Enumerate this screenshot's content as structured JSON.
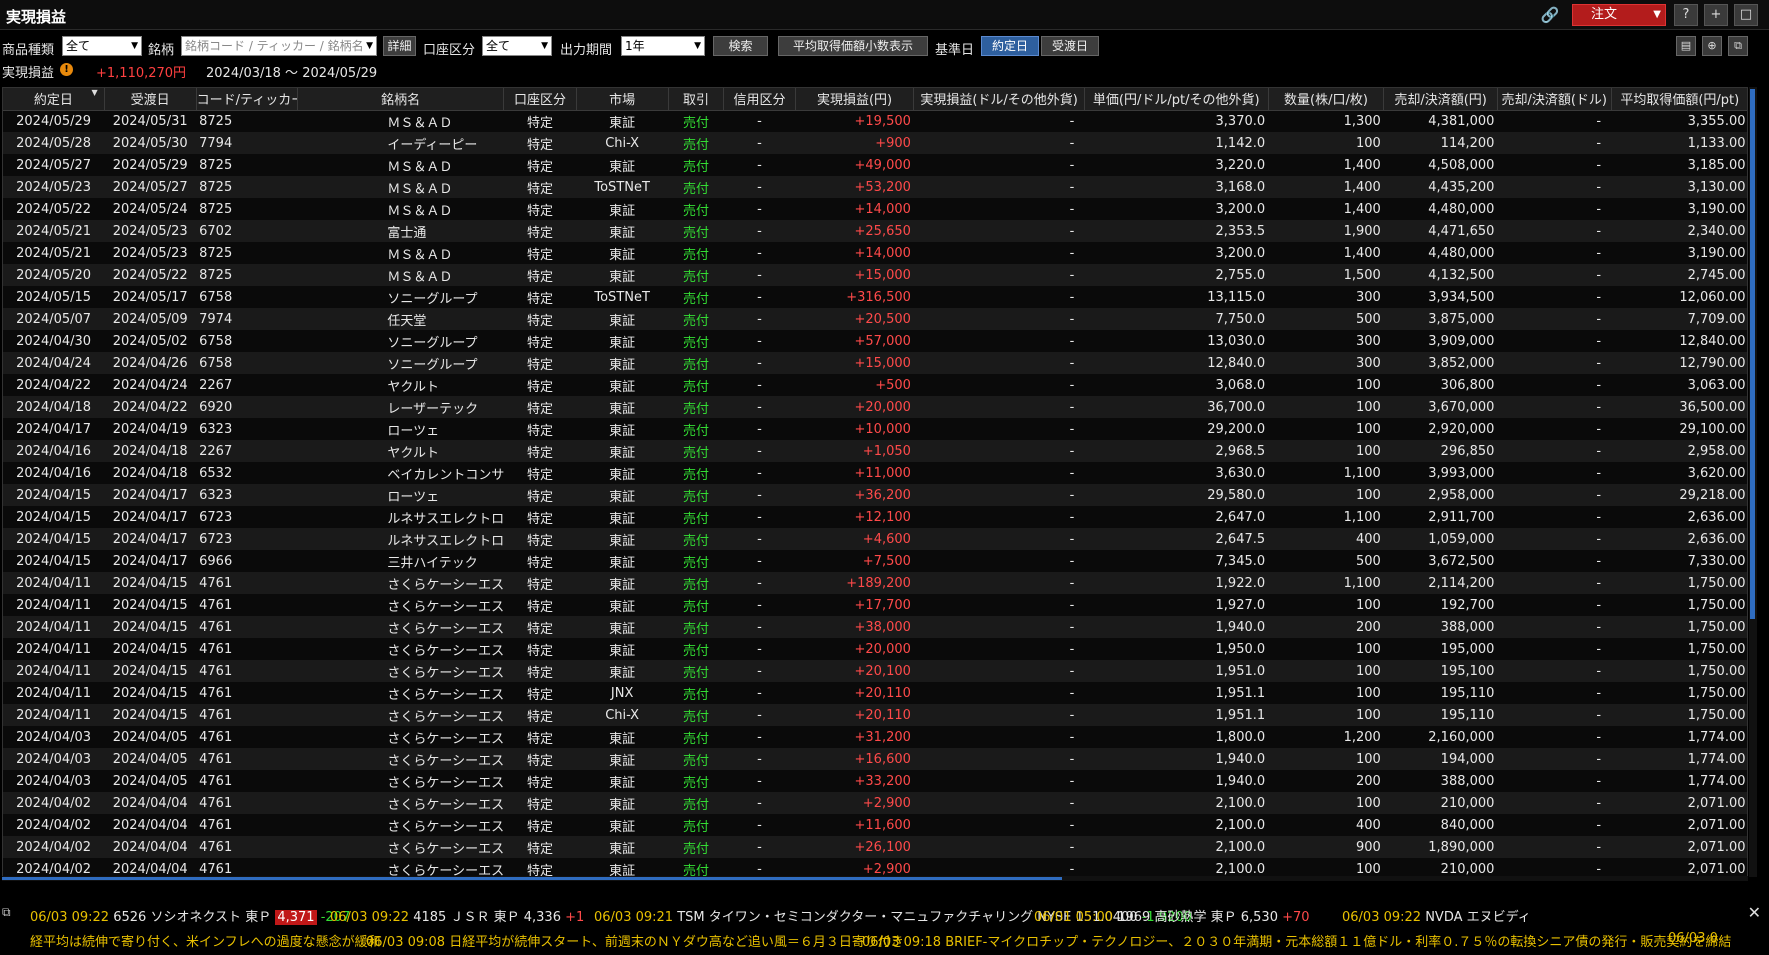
{
  "window": {
    "title": "実現損益",
    "order_label": "注文",
    "buttons": [
      "?",
      "+",
      "□"
    ]
  },
  "filters": {
    "product_type_label": "商品種類",
    "product_type_value": "全て",
    "symbol_label": "銘柄",
    "symbol_placeholder": "銘柄コード / ティッカー / 銘柄名",
    "detail_button": "詳細",
    "account_label": "口座区分",
    "account_value": "全て",
    "period_label": "出力期間",
    "period_value": "1年",
    "search_button": "検索",
    "avg_price_button": "平均取得価額小数表示",
    "base_date_label": "基準日",
    "trade_date_button": "約定日",
    "settle_date_button": "受渡日"
  },
  "summary": {
    "label": "実現損益",
    "total": "+1,110,270円",
    "period": "2024/03/18 ～ 2024/05/29"
  },
  "table": {
    "columns": [
      "約定日",
      "受渡日",
      "コード/ティッカー",
      "銘柄名",
      "口座区分",
      "市場",
      "取引",
      "信用区分",
      "実現損益(円)",
      "実現損益(ドル/その他外貨)",
      "単価(円/ドル/pt/その他外貨)",
      "数量(株/口/枚)",
      "売却/決済額(円)",
      "売却/決済額(ドル)",
      "平均取得価額(円/pt)"
    ],
    "rows": [
      [
        "2024/05/29",
        "2024/05/31",
        "8725",
        "ＭＳ＆ＡＤ",
        "特定",
        "東証",
        "売付",
        "-",
        "+19,500",
        "-",
        "3,370.0",
        "1,300",
        "4,381,000",
        "-",
        "3,355.00"
      ],
      [
        "2024/05/28",
        "2024/05/30",
        "7794",
        "イーディーピー",
        "特定",
        "Chi-X",
        "売付",
        "-",
        "+900",
        "-",
        "1,142.0",
        "100",
        "114,200",
        "-",
        "1,133.00"
      ],
      [
        "2024/05/27",
        "2024/05/29",
        "8725",
        "ＭＳ＆ＡＤ",
        "特定",
        "東証",
        "売付",
        "-",
        "+49,000",
        "-",
        "3,220.0",
        "1,400",
        "4,508,000",
        "-",
        "3,185.00"
      ],
      [
        "2024/05/23",
        "2024/05/27",
        "8725",
        "ＭＳ＆ＡＤ",
        "特定",
        "ToSTNeT",
        "売付",
        "-",
        "+53,200",
        "-",
        "3,168.0",
        "1,400",
        "4,435,200",
        "-",
        "3,130.00"
      ],
      [
        "2024/05/22",
        "2024/05/24",
        "8725",
        "ＭＳ＆ＡＤ",
        "特定",
        "東証",
        "売付",
        "-",
        "+14,000",
        "-",
        "3,200.0",
        "1,400",
        "4,480,000",
        "-",
        "3,190.00"
      ],
      [
        "2024/05/21",
        "2024/05/23",
        "6702",
        "富士通",
        "特定",
        "東証",
        "売付",
        "-",
        "+25,650",
        "-",
        "2,353.5",
        "1,900",
        "4,471,650",
        "-",
        "2,340.00"
      ],
      [
        "2024/05/21",
        "2024/05/23",
        "8725",
        "ＭＳ＆ＡＤ",
        "特定",
        "東証",
        "売付",
        "-",
        "+14,000",
        "-",
        "3,200.0",
        "1,400",
        "4,480,000",
        "-",
        "3,190.00"
      ],
      [
        "2024/05/20",
        "2024/05/22",
        "8725",
        "ＭＳ＆ＡＤ",
        "特定",
        "東証",
        "売付",
        "-",
        "+15,000",
        "-",
        "2,755.0",
        "1,500",
        "4,132,500",
        "-",
        "2,745.00"
      ],
      [
        "2024/05/15",
        "2024/05/17",
        "6758",
        "ソニーグループ",
        "特定",
        "ToSTNeT",
        "売付",
        "-",
        "+316,500",
        "-",
        "13,115.0",
        "300",
        "3,934,500",
        "-",
        "12,060.00"
      ],
      [
        "2024/05/07",
        "2024/05/09",
        "7974",
        "任天堂",
        "特定",
        "東証",
        "売付",
        "-",
        "+20,500",
        "-",
        "7,750.0",
        "500",
        "3,875,000",
        "-",
        "7,709.00"
      ],
      [
        "2024/04/30",
        "2024/05/02",
        "6758",
        "ソニーグループ",
        "特定",
        "東証",
        "売付",
        "-",
        "+57,000",
        "-",
        "13,030.0",
        "300",
        "3,909,000",
        "-",
        "12,840.00"
      ],
      [
        "2024/04/24",
        "2024/04/26",
        "6758",
        "ソニーグループ",
        "特定",
        "東証",
        "売付",
        "-",
        "+15,000",
        "-",
        "12,840.0",
        "300",
        "3,852,000",
        "-",
        "12,790.00"
      ],
      [
        "2024/04/22",
        "2024/04/24",
        "2267",
        "ヤクルト",
        "特定",
        "東証",
        "売付",
        "-",
        "+500",
        "-",
        "3,068.0",
        "100",
        "306,800",
        "-",
        "3,063.00"
      ],
      [
        "2024/04/18",
        "2024/04/22",
        "6920",
        "レーザーテック",
        "特定",
        "東証",
        "売付",
        "-",
        "+20,000",
        "-",
        "36,700.0",
        "100",
        "3,670,000",
        "-",
        "36,500.00"
      ],
      [
        "2024/04/17",
        "2024/04/19",
        "6323",
        "ローツェ",
        "特定",
        "東証",
        "売付",
        "-",
        "+10,000",
        "-",
        "29,200.0",
        "100",
        "2,920,000",
        "-",
        "29,100.00"
      ],
      [
        "2024/04/16",
        "2024/04/18",
        "2267",
        "ヤクルト",
        "特定",
        "東証",
        "売付",
        "-",
        "+1,050",
        "-",
        "2,968.5",
        "100",
        "296,850",
        "-",
        "2,958.00"
      ],
      [
        "2024/04/16",
        "2024/04/18",
        "6532",
        "ベイカレントコンサルティング",
        "特定",
        "東証",
        "売付",
        "-",
        "+11,000",
        "-",
        "3,630.0",
        "1,100",
        "3,993,000",
        "-",
        "3,620.00"
      ],
      [
        "2024/04/15",
        "2024/04/17",
        "6323",
        "ローツェ",
        "特定",
        "東証",
        "売付",
        "-",
        "+36,200",
        "-",
        "29,580.0",
        "100",
        "2,958,000",
        "-",
        "29,218.00"
      ],
      [
        "2024/04/15",
        "2024/04/17",
        "6723",
        "ルネサスエレクトロニクス",
        "特定",
        "東証",
        "売付",
        "-",
        "+12,100",
        "-",
        "2,647.0",
        "1,100",
        "2,911,700",
        "-",
        "2,636.00"
      ],
      [
        "2024/04/15",
        "2024/04/17",
        "6723",
        "ルネサスエレクトロニクス",
        "特定",
        "東証",
        "売付",
        "-",
        "+4,600",
        "-",
        "2,647.5",
        "400",
        "1,059,000",
        "-",
        "2,636.00"
      ],
      [
        "2024/04/15",
        "2024/04/17",
        "6966",
        "三井ハイテック",
        "特定",
        "東証",
        "売付",
        "-",
        "+7,500",
        "-",
        "7,345.0",
        "500",
        "3,672,500",
        "-",
        "7,330.00"
      ],
      [
        "2024/04/11",
        "2024/04/15",
        "4761",
        "さくらケーシーエス",
        "特定",
        "東証",
        "売付",
        "-",
        "+189,200",
        "-",
        "1,922.0",
        "1,100",
        "2,114,200",
        "-",
        "1,750.00"
      ],
      [
        "2024/04/11",
        "2024/04/15",
        "4761",
        "さくらケーシーエス",
        "特定",
        "東証",
        "売付",
        "-",
        "+17,700",
        "-",
        "1,927.0",
        "100",
        "192,700",
        "-",
        "1,750.00"
      ],
      [
        "2024/04/11",
        "2024/04/15",
        "4761",
        "さくらケーシーエス",
        "特定",
        "東証",
        "売付",
        "-",
        "+38,000",
        "-",
        "1,940.0",
        "200",
        "388,000",
        "-",
        "1,750.00"
      ],
      [
        "2024/04/11",
        "2024/04/15",
        "4761",
        "さくらケーシーエス",
        "特定",
        "東証",
        "売付",
        "-",
        "+20,000",
        "-",
        "1,950.0",
        "100",
        "195,000",
        "-",
        "1,750.00"
      ],
      [
        "2024/04/11",
        "2024/04/15",
        "4761",
        "さくらケーシーエス",
        "特定",
        "東証",
        "売付",
        "-",
        "+20,100",
        "-",
        "1,951.0",
        "100",
        "195,100",
        "-",
        "1,750.00"
      ],
      [
        "2024/04/11",
        "2024/04/15",
        "4761",
        "さくらケーシーエス",
        "特定",
        "JNX",
        "売付",
        "-",
        "+20,110",
        "-",
        "1,951.1",
        "100",
        "195,110",
        "-",
        "1,750.00"
      ],
      [
        "2024/04/11",
        "2024/04/15",
        "4761",
        "さくらケーシーエス",
        "特定",
        "Chi-X",
        "売付",
        "-",
        "+20,110",
        "-",
        "1,951.1",
        "100",
        "195,110",
        "-",
        "1,750.00"
      ],
      [
        "2024/04/03",
        "2024/04/05",
        "4761",
        "さくらケーシーエス",
        "特定",
        "東証",
        "売付",
        "-",
        "+31,200",
        "-",
        "1,800.0",
        "1,200",
        "2,160,000",
        "-",
        "1,774.00"
      ],
      [
        "2024/04/03",
        "2024/04/05",
        "4761",
        "さくらケーシーエス",
        "特定",
        "東証",
        "売付",
        "-",
        "+16,600",
        "-",
        "1,940.0",
        "100",
        "194,000",
        "-",
        "1,774.00"
      ],
      [
        "2024/04/03",
        "2024/04/05",
        "4761",
        "さくらケーシーエス",
        "特定",
        "東証",
        "売付",
        "-",
        "+33,200",
        "-",
        "1,940.0",
        "200",
        "388,000",
        "-",
        "1,774.00"
      ],
      [
        "2024/04/02",
        "2024/04/04",
        "4761",
        "さくらケーシーエス",
        "特定",
        "東証",
        "売付",
        "-",
        "+2,900",
        "-",
        "2,100.0",
        "100",
        "210,000",
        "-",
        "2,071.00"
      ],
      [
        "2024/04/02",
        "2024/04/04",
        "4761",
        "さくらケーシーエス",
        "特定",
        "東証",
        "売付",
        "-",
        "+11,600",
        "-",
        "2,100.0",
        "400",
        "840,000",
        "-",
        "2,071.00"
      ],
      [
        "2024/04/02",
        "2024/04/04",
        "4761",
        "さくらケーシーエス",
        "特定",
        "東証",
        "売付",
        "-",
        "+26,100",
        "-",
        "2,100.0",
        "900",
        "1,890,000",
        "-",
        "2,071.00"
      ],
      [
        "2024/04/02",
        "2024/04/04",
        "4761",
        "さくらケーシーエス",
        "特定",
        "東証",
        "売付",
        "-",
        "+2,900",
        "-",
        "2,100.0",
        "100",
        "210,000",
        "-",
        "2,071.00"
      ]
    ]
  },
  "ticker1": [
    {
      "time": "06/03  09:22",
      "code": "6526",
      "name": "ソシオネクスト",
      "market": "東Ｐ",
      "price": "4,371",
      "change": "-207",
      "highlight": true
    },
    {
      "time": "06/03  09:22",
      "code": "4185",
      "name": "ＪＳＲ",
      "market": "東Ｐ",
      "price": "4,336",
      "change": "+1",
      "highlight": false
    },
    {
      "time": "06/03  09:21",
      "code": "TSM",
      "name": "タイワン・セミコンダクター・マニュファクチャリング",
      "market": "NYSE",
      "price": "151.0400",
      "change": "-1.9200",
      "highlight": false
    },
    {
      "time": "06/01  05:00",
      "code": "1969",
      "name": "高砂熱学",
      "market": "東Ｐ",
      "price": "6,530",
      "change": "+70",
      "highlight": false
    },
    {
      "time": "06/03  09:22",
      "code": "NVDA",
      "name": "エヌビディ",
      "market": "",
      "price": "",
      "change": "",
      "highlight": false
    }
  ],
  "ticker2": [
    "経平均は続伸で寄り付く、米インフレへの過度な懸念が緩和",
    "06/03 09:08  日経平均が続伸スタート、前週末のＮＹダウ高など追い風＝６月３日寄り付き",
    "06/03 09:18  BRIEF-マイクロチップ・テクノロジー、２０３０年満期・元本総額１１億ドル・利率０.７５％の転換シニア債の発行・販売契約を締結",
    "06/03 0"
  ]
}
